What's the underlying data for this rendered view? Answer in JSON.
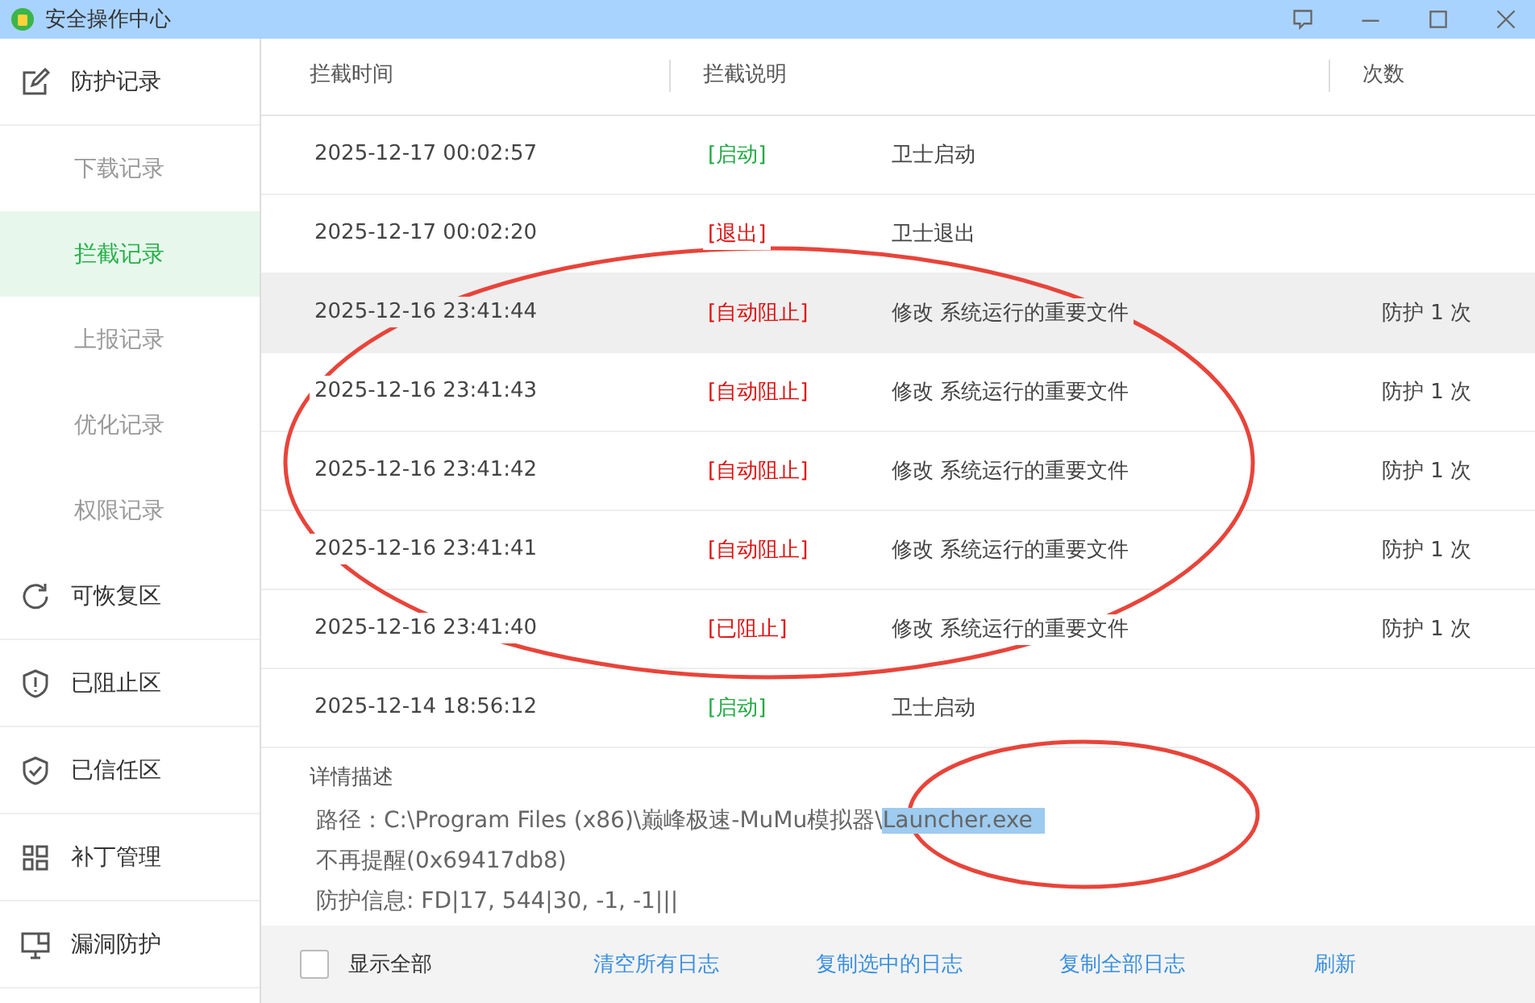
{
  "window": {
    "title": "安全操作中心"
  },
  "sidebar": {
    "items": [
      {
        "label": "防护记录",
        "kind": "main",
        "selected": false
      },
      {
        "label": "下载记录",
        "kind": "sub",
        "selected": false
      },
      {
        "label": "拦截记录",
        "kind": "sub",
        "selected": true
      },
      {
        "label": "上报记录",
        "kind": "sub",
        "selected": false
      },
      {
        "label": "优化记录",
        "kind": "sub",
        "selected": false
      },
      {
        "label": "权限记录",
        "kind": "sub",
        "selected": false
      },
      {
        "label": "可恢复区",
        "kind": "main",
        "selected": false
      },
      {
        "label": "已阻止区",
        "kind": "main",
        "selected": false
      },
      {
        "label": "已信任区",
        "kind": "main",
        "selected": false
      },
      {
        "label": "补丁管理",
        "kind": "main",
        "selected": false
      },
      {
        "label": "漏洞防护",
        "kind": "main",
        "selected": false
      }
    ]
  },
  "table": {
    "columns": [
      "拦截时间",
      "拦截说明",
      "次数"
    ],
    "rows": [
      {
        "time": "2025-12-17 00:02:57",
        "tag": "[启动]",
        "color": "#22aa44",
        "description": "卫士启动",
        "count": "",
        "selected": false
      },
      {
        "time": "2025-12-17 00:02:20",
        "tag": "[退出]",
        "color": "#dd1111",
        "description": "卫士退出",
        "count": "",
        "selected": false
      },
      {
        "time": "2025-12-16 23:41:44",
        "tag": "[自动阻止]",
        "color": "#dd1111",
        "description": "修改 系统运行的重要文件",
        "count": "防护 1 次",
        "selected": true
      },
      {
        "time": "2025-12-16 23:41:43",
        "tag": "[自动阻止]",
        "color": "#dd1111",
        "description": "修改 系统运行的重要文件",
        "count": "防护 1 次",
        "selected": false
      },
      {
        "time": "2025-12-16 23:41:42",
        "tag": "[自动阻止]",
        "color": "#dd1111",
        "description": "修改 系统运行的重要文件",
        "count": "防护 1 次",
        "selected": false
      },
      {
        "time": "2025-12-16 23:41:41",
        "tag": "[自动阻止]",
        "color": "#dd1111",
        "description": "修改 系统运行的重要文件",
        "count": "防护 1 次",
        "selected": false
      },
      {
        "time": "2025-12-16 23:41:40",
        "tag": "[已阻止]",
        "color": "#dd1111",
        "description": "修改 系统运行的重要文件",
        "count": "防护 1 次",
        "selected": false
      },
      {
        "time": "2025-12-14 18:56:12",
        "tag": "[启动]",
        "color": "#22aa44",
        "description": "卫士启动",
        "count": "",
        "selected": false
      }
    ]
  },
  "details": {
    "title": "详情描述",
    "path_prefix": "路径：C:\\Program Files (x86)\\巅峰极速-MuMu模拟器\\",
    "path_selected": "Launcher.exe",
    "lines": [
      "不再提醒(0x69417db8)",
      "防护信息: FD|17, 544|30, -1, -1|||"
    ]
  },
  "footer": {
    "show_all": {
      "label": "显示全部",
      "checked": false
    },
    "links": [
      "清空所有日志",
      "复制选中的日志",
      "复制全部日志",
      "刷新"
    ]
  }
}
